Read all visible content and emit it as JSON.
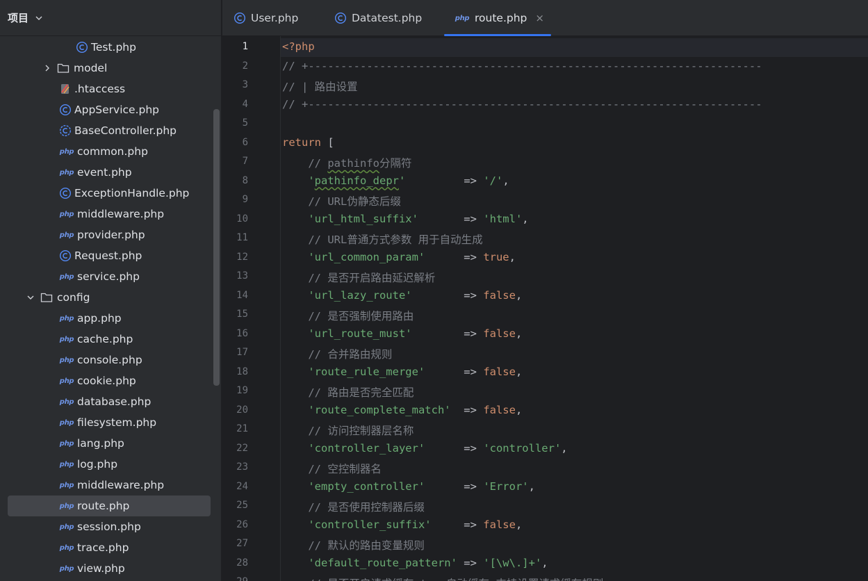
{
  "sidebar": {
    "title": "项目",
    "items": [
      {
        "label": "Test.php",
        "type": "class",
        "indent": 3,
        "arrow": "none"
      },
      {
        "label": "model",
        "type": "folder",
        "indent": 2,
        "arrow": "right"
      },
      {
        "label": ".htaccess",
        "type": "htaccess",
        "indent": 3,
        "arrow": "none"
      },
      {
        "label": "AppService.php",
        "type": "class",
        "indent": 3,
        "arrow": "none"
      },
      {
        "label": "BaseController.php",
        "type": "class-abstract",
        "indent": 3,
        "arrow": "none"
      },
      {
        "label": "common.php",
        "type": "php",
        "indent": 3,
        "arrow": "none"
      },
      {
        "label": "event.php",
        "type": "php",
        "indent": 3,
        "arrow": "none"
      },
      {
        "label": "ExceptionHandle.php",
        "type": "class",
        "indent": 3,
        "arrow": "none"
      },
      {
        "label": "middleware.php",
        "type": "php",
        "indent": 3,
        "arrow": "none"
      },
      {
        "label": "provider.php",
        "type": "php",
        "indent": 3,
        "arrow": "none"
      },
      {
        "label": "Request.php",
        "type": "class",
        "indent": 3,
        "arrow": "none"
      },
      {
        "label": "service.php",
        "type": "php",
        "indent": 3,
        "arrow": "none"
      },
      {
        "label": "config",
        "type": "folder",
        "indent": 1,
        "arrow": "down"
      },
      {
        "label": "app.php",
        "type": "php",
        "indent": 3,
        "arrow": "none"
      },
      {
        "label": "cache.php",
        "type": "php",
        "indent": 3,
        "arrow": "none"
      },
      {
        "label": "console.php",
        "type": "php",
        "indent": 3,
        "arrow": "none"
      },
      {
        "label": "cookie.php",
        "type": "php",
        "indent": 3,
        "arrow": "none"
      },
      {
        "label": "database.php",
        "type": "php",
        "indent": 3,
        "arrow": "none"
      },
      {
        "label": "filesystem.php",
        "type": "php",
        "indent": 3,
        "arrow": "none"
      },
      {
        "label": "lang.php",
        "type": "php",
        "indent": 3,
        "arrow": "none"
      },
      {
        "label": "log.php",
        "type": "php",
        "indent": 3,
        "arrow": "none"
      },
      {
        "label": "middleware.php",
        "type": "php",
        "indent": 3,
        "arrow": "none"
      },
      {
        "label": "route.php",
        "type": "php",
        "indent": 3,
        "arrow": "none",
        "selected": true
      },
      {
        "label": "session.php",
        "type": "php",
        "indent": 3,
        "arrow": "none"
      },
      {
        "label": "trace.php",
        "type": "php",
        "indent": 3,
        "arrow": "none"
      },
      {
        "label": "view.php",
        "type": "php",
        "indent": 3,
        "arrow": "none"
      }
    ]
  },
  "tabs": [
    {
      "label": "User.php",
      "icon": "class-icon",
      "active": false
    },
    {
      "label": "Datatest.php",
      "icon": "class-icon",
      "active": false
    },
    {
      "label": "route.php",
      "icon": "php-file-icon",
      "active": true,
      "close": "×"
    }
  ],
  "php_badge": "php",
  "editor": {
    "current_line": 1,
    "lines": [
      [
        [
          "kw",
          "<?php"
        ]
      ],
      [
        [
          "cm",
          "// +----------------------------------------------------------------------"
        ]
      ],
      [
        [
          "cm",
          "// | 路由设置"
        ]
      ],
      [
        [
          "cm",
          "// +----------------------------------------------------------------------"
        ]
      ],
      [],
      [
        [
          "kw",
          "return"
        ],
        [
          "op",
          " ["
        ]
      ],
      [
        [
          "op",
          "    "
        ],
        [
          "cm",
          "// "
        ],
        [
          "cmu",
          "pathinfo"
        ],
        [
          "cm",
          "分隔符"
        ]
      ],
      [
        [
          "op",
          "    "
        ],
        [
          "str",
          "'"
        ],
        [
          "stru",
          "pathinfo_depr"
        ],
        [
          "str",
          "'"
        ],
        [
          "op",
          "         => "
        ],
        [
          "str",
          "'/'"
        ],
        [
          "op",
          ","
        ]
      ],
      [
        [
          "op",
          "    "
        ],
        [
          "cm",
          "// URL伪静态后缀"
        ]
      ],
      [
        [
          "op",
          "    "
        ],
        [
          "str",
          "'url_html_suffix'"
        ],
        [
          "op",
          "       => "
        ],
        [
          "str",
          "'html'"
        ],
        [
          "op",
          ","
        ]
      ],
      [
        [
          "op",
          "    "
        ],
        [
          "cm",
          "// URL普通方式参数 用于自动生成"
        ]
      ],
      [
        [
          "op",
          "    "
        ],
        [
          "str",
          "'url_common_param'"
        ],
        [
          "op",
          "      => "
        ],
        [
          "kw",
          "true"
        ],
        [
          "op",
          ","
        ]
      ],
      [
        [
          "op",
          "    "
        ],
        [
          "cm",
          "// 是否开启路由延迟解析"
        ]
      ],
      [
        [
          "op",
          "    "
        ],
        [
          "str",
          "'url_lazy_route'"
        ],
        [
          "op",
          "        => "
        ],
        [
          "kw",
          "false"
        ],
        [
          "op",
          ","
        ]
      ],
      [
        [
          "op",
          "    "
        ],
        [
          "cm",
          "// 是否强制使用路由"
        ]
      ],
      [
        [
          "op",
          "    "
        ],
        [
          "str",
          "'url_route_must'"
        ],
        [
          "op",
          "        => "
        ],
        [
          "kw",
          "false"
        ],
        [
          "op",
          ","
        ]
      ],
      [
        [
          "op",
          "    "
        ],
        [
          "cm",
          "// 合并路由规则"
        ]
      ],
      [
        [
          "op",
          "    "
        ],
        [
          "str",
          "'route_rule_merge'"
        ],
        [
          "op",
          "      => "
        ],
        [
          "kw",
          "false"
        ],
        [
          "op",
          ","
        ]
      ],
      [
        [
          "op",
          "    "
        ],
        [
          "cm",
          "// 路由是否完全匹配"
        ]
      ],
      [
        [
          "op",
          "    "
        ],
        [
          "str",
          "'route_complete_match'"
        ],
        [
          "op",
          "  => "
        ],
        [
          "kw",
          "false"
        ],
        [
          "op",
          ","
        ]
      ],
      [
        [
          "op",
          "    "
        ],
        [
          "cm",
          "// 访问控制器层名称"
        ]
      ],
      [
        [
          "op",
          "    "
        ],
        [
          "str",
          "'controller_layer'"
        ],
        [
          "op",
          "      => "
        ],
        [
          "str",
          "'controller'"
        ],
        [
          "op",
          ","
        ]
      ],
      [
        [
          "op",
          "    "
        ],
        [
          "cm",
          "// 空控制器名"
        ]
      ],
      [
        [
          "op",
          "    "
        ],
        [
          "str",
          "'empty_controller'"
        ],
        [
          "op",
          "      => "
        ],
        [
          "str",
          "'Error'"
        ],
        [
          "op",
          ","
        ]
      ],
      [
        [
          "op",
          "    "
        ],
        [
          "cm",
          "// 是否使用控制器后缀"
        ]
      ],
      [
        [
          "op",
          "    "
        ],
        [
          "str",
          "'controller_suffix'"
        ],
        [
          "op",
          "     => "
        ],
        [
          "kw",
          "false"
        ],
        [
          "op",
          ","
        ]
      ],
      [
        [
          "op",
          "    "
        ],
        [
          "cm",
          "// 默认的路由变量规则"
        ]
      ],
      [
        [
          "op",
          "    "
        ],
        [
          "str",
          "'default_route_pattern'"
        ],
        [
          "op",
          " => "
        ],
        [
          "str",
          "'[\\w\\.]+'"
        ],
        [
          "op",
          ","
        ]
      ],
      [
        [
          "op",
          "    "
        ],
        [
          "cm",
          "// 是否开启请求缓存 true自动缓存 支持设置请求缓存规则"
        ]
      ]
    ]
  }
}
